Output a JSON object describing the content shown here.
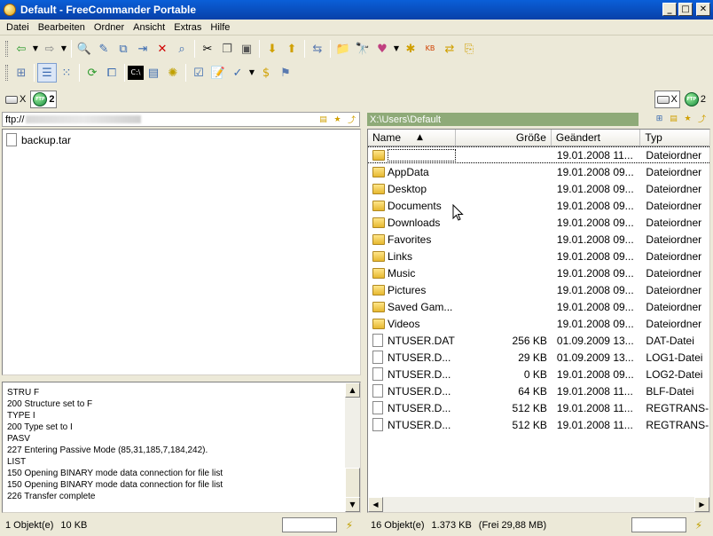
{
  "window": {
    "title": "Default - FreeCommander  Portable"
  },
  "menu": [
    "Datei",
    "Bearbeiten",
    "Ordner",
    "Ansicht",
    "Extras",
    "Hilfe"
  ],
  "left": {
    "drive_label": "X",
    "ftp_label": "2",
    "path": "ftp://",
    "files": [
      {
        "name": "backup.tar"
      }
    ],
    "log": [
      "STRU F",
      "200 Structure set to F",
      "TYPE I",
      "200 Type set to I",
      "PASV",
      "227 Entering Passive Mode (85,31,185,7,184,242).",
      "LIST",
      "150 Opening BINARY mode data connection for file list",
      "150 Opening BINARY mode data connection for file list",
      "226 Transfer complete"
    ],
    "status": {
      "objects": "1 Objekt(e)",
      "size": "10 KB"
    }
  },
  "right": {
    "drive_label": "X",
    "ftp_label": "2",
    "path": "X:\\Users\\Default",
    "columns": {
      "name": "Name",
      "size": "Größe",
      "date": "Geändert",
      "type": "Typ"
    },
    "rows": [
      {
        "name": "",
        "size": "",
        "date": "19.01.2008 11...",
        "type": "Dateiordner",
        "kind": "folder"
      },
      {
        "name": "AppData",
        "size": "",
        "date": "19.01.2008 09...",
        "type": "Dateiordner",
        "kind": "folder"
      },
      {
        "name": "Desktop",
        "size": "",
        "date": "19.01.2008 09...",
        "type": "Dateiordner",
        "kind": "folder"
      },
      {
        "name": "Documents",
        "size": "",
        "date": "19.01.2008 09...",
        "type": "Dateiordner",
        "kind": "folder"
      },
      {
        "name": "Downloads",
        "size": "",
        "date": "19.01.2008 09...",
        "type": "Dateiordner",
        "kind": "folder"
      },
      {
        "name": "Favorites",
        "size": "",
        "date": "19.01.2008 09...",
        "type": "Dateiordner",
        "kind": "folder"
      },
      {
        "name": "Links",
        "size": "",
        "date": "19.01.2008 09...",
        "type": "Dateiordner",
        "kind": "folder"
      },
      {
        "name": "Music",
        "size": "",
        "date": "19.01.2008 09...",
        "type": "Dateiordner",
        "kind": "folder"
      },
      {
        "name": "Pictures",
        "size": "",
        "date": "19.01.2008 09...",
        "type": "Dateiordner",
        "kind": "folder"
      },
      {
        "name": "Saved Gam...",
        "size": "",
        "date": "19.01.2008 09...",
        "type": "Dateiordner",
        "kind": "folder"
      },
      {
        "name": "Videos",
        "size": "",
        "date": "19.01.2008 09...",
        "type": "Dateiordner",
        "kind": "folder"
      },
      {
        "name": "NTUSER.DAT",
        "size": "256 KB",
        "date": "01.09.2009 13...",
        "type": "DAT-Datei",
        "kind": "file"
      },
      {
        "name": "NTUSER.D...",
        "size": "29 KB",
        "date": "01.09.2009 13...",
        "type": "LOG1-Datei",
        "kind": "file"
      },
      {
        "name": "NTUSER.D...",
        "size": "0 KB",
        "date": "19.01.2008 09...",
        "type": "LOG2-Datei",
        "kind": "file"
      },
      {
        "name": "NTUSER.D...",
        "size": "64 KB",
        "date": "19.01.2008 11...",
        "type": "BLF-Datei",
        "kind": "file"
      },
      {
        "name": "NTUSER.D...",
        "size": "512 KB",
        "date": "19.01.2008 11...",
        "type": "REGTRANS-...",
        "kind": "file"
      },
      {
        "name": "NTUSER.D...",
        "size": "512 KB",
        "date": "19.01.2008 11...",
        "type": "REGTRANS-...",
        "kind": "file"
      }
    ],
    "status": {
      "objects": "16 Objekt(e)",
      "size": "1.373 KB",
      "free": "(Frei 29,88 MB)"
    }
  },
  "colors": {
    "title_bg": "#0a5fd8",
    "path_active": "#8eaa78",
    "chrome": "#ece9d8"
  }
}
